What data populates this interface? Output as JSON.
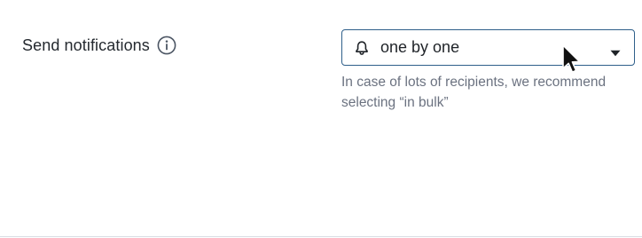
{
  "notifications": {
    "label": "Send notifications",
    "info_icon": "info-circle-icon",
    "select": {
      "value": "one by one",
      "icon": "bell-icon",
      "dropdown_icon": "caret-down-icon"
    },
    "helper_text": "In case of lots of recipients, we recommend selecting “in bulk”"
  },
  "colors": {
    "select_border": "#2f5f8a",
    "text_primary": "#24292f",
    "text_secondary": "#6b7280"
  }
}
